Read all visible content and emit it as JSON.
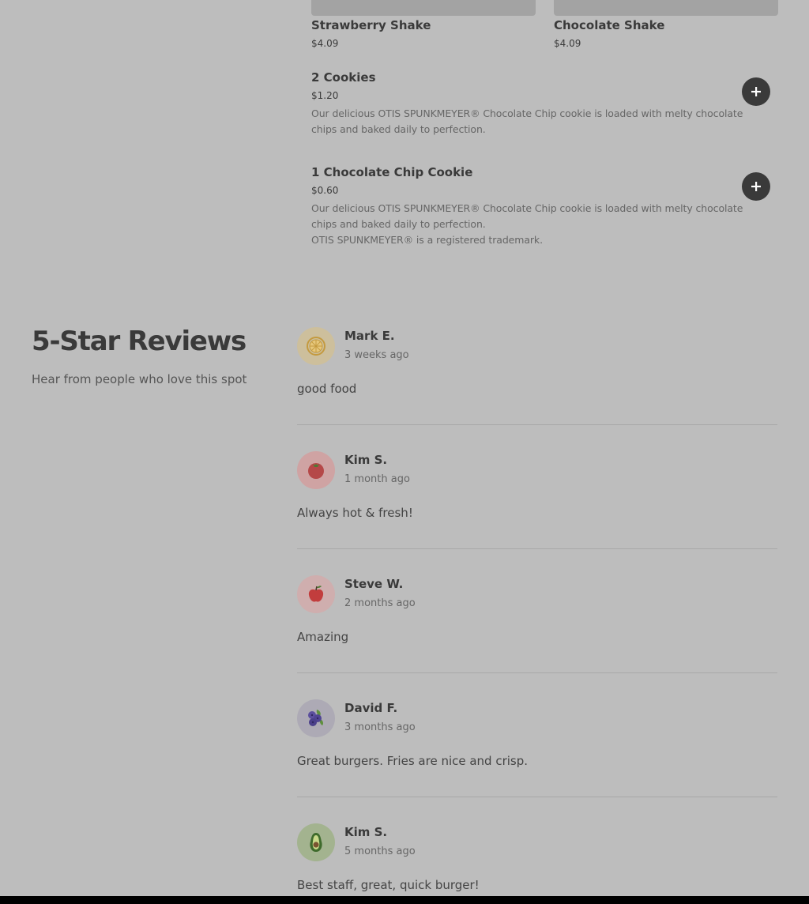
{
  "menu": {
    "shakes": [
      {
        "name": "Strawberry Shake",
        "price": "$4.09"
      },
      {
        "name": "Chocolate Shake",
        "price": "$4.09"
      }
    ],
    "items": [
      {
        "name": "2 Cookies",
        "price": "$1.20",
        "description": "Our delicious OTIS SPUNKMEYER® Chocolate Chip cookie is loaded with melty chocolate chips and baked daily to perfection.",
        "note": ""
      },
      {
        "name": "1 Chocolate Chip Cookie",
        "price": "$0.60",
        "description": "Our delicious OTIS SPUNKMEYER® Chocolate Chip cookie is loaded with melty chocolate chips and baked daily to perfection.",
        "note": "OTIS SPUNKMEYER® is a registered trademark."
      }
    ],
    "add_icon": "plus-icon"
  },
  "reviews": {
    "title": "5-Star Reviews",
    "subtitle": "Hear from people who love this spot",
    "items": [
      {
        "name": "Mark E.",
        "when": "3 weeks ago",
        "text": "good food",
        "avatar": "lemon-icon",
        "avatar_bg": "#cdbf9c"
      },
      {
        "name": "Kim S.",
        "when": "1 month ago",
        "text": "Always hot & fresh!",
        "avatar": "tomato-icon",
        "avatar_bg": "#cfa3a3"
      },
      {
        "name": "Steve W.",
        "when": "2 months ago",
        "text": "Amazing",
        "avatar": "apple-icon",
        "avatar_bg": "#cfaeae"
      },
      {
        "name": "David F.",
        "when": "3 months ago",
        "text": "Great burgers. Fries are nice and crisp.",
        "avatar": "blueberry-icon",
        "avatar_bg": "#adaab5"
      },
      {
        "name": "Kim S.",
        "when": "5 months ago",
        "text": "Best staff, great, quick burger!",
        "avatar": "avocado-icon",
        "avatar_bg": "#a3b38f"
      }
    ]
  }
}
